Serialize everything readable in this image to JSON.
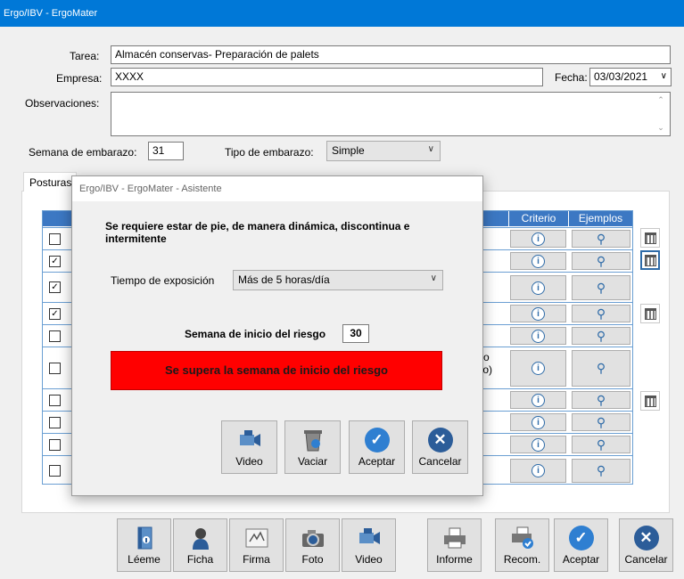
{
  "window": {
    "title": "Ergo/IBV - ErgoMater"
  },
  "form": {
    "tarea_label": "Tarea:",
    "tarea_value": "Almacén conservas- Preparación de palets",
    "empresa_label": "Empresa:",
    "empresa_value": "XXXX",
    "fecha_label": "Fecha:",
    "fecha_value": "03/03/2021",
    "observaciones_label": "Observaciones:",
    "observaciones_value": "",
    "semana_label": "Semana de embarazo:",
    "semana_value": "31",
    "tipo_label": "Tipo de embarazo:",
    "tipo_value": "Simple"
  },
  "tab": {
    "label": "Posturas"
  },
  "grid": {
    "headers": [
      "Criterio",
      "Ejemplos"
    ],
    "checked": [
      false,
      true,
      true,
      true,
      false,
      false,
      false,
      false,
      false,
      false
    ],
    "row6_text": "ro\nto)"
  },
  "modal": {
    "title": "Ergo/IBV - ErgoMater - Asistente",
    "question": "Se requiere estar de pie, de manera dinámica, discontinua e intermitente",
    "exposure_label": "Tiempo de exposición",
    "exposure_value": "Más de 5 horas/día",
    "risk_week_label": "Semana de inicio del riesgo",
    "risk_week_value": "30",
    "alert_text": "Se supera la semana de inicio del riesgo",
    "alert_color": "#ff0000",
    "buttons": {
      "video": "Video",
      "vaciar": "Vaciar",
      "aceptar": "Aceptar",
      "cancelar": "Cancelar"
    }
  },
  "toolbar": {
    "leeme": "Léeme",
    "ficha": "Ficha",
    "firma": "Firma",
    "foto": "Foto",
    "video": "Video",
    "informe": "Informe",
    "recom": "Recom.",
    "aceptar": "Aceptar",
    "cancelar": "Cancelar"
  },
  "colors": {
    "titlebar": "#0078d7",
    "grid_header": "#3c78c3",
    "accent": "#2f7fd1"
  }
}
